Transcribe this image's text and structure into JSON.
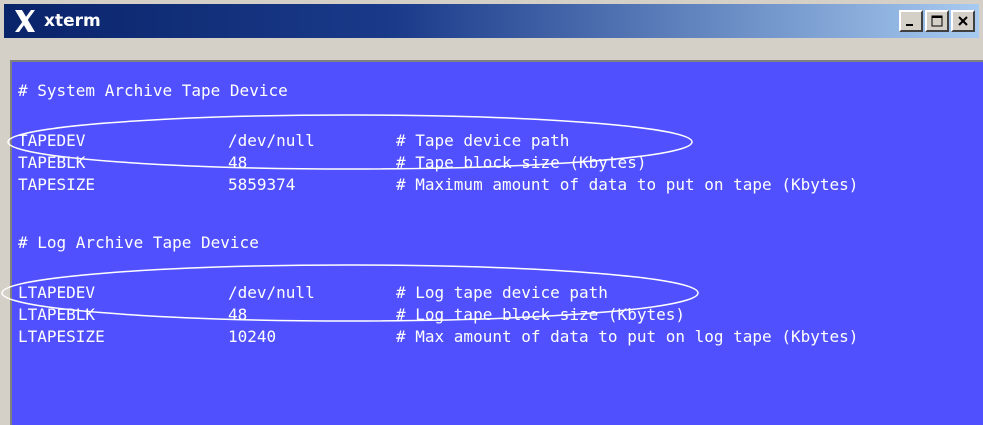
{
  "window": {
    "title": "xterm",
    "buttons": {
      "minimize": "minimize",
      "maximize": "maximize",
      "close": "close"
    }
  },
  "terminal": {
    "background": "#5050ff",
    "foreground": "#ffffff",
    "system_header": "# System Archive Tape Device",
    "system_rows": [
      {
        "name": "TAPEDEV",
        "value": "/dev/null",
        "comment": "# Tape device path"
      },
      {
        "name": "TAPEBLK",
        "value": "48",
        "comment": "# Tape block size (Kbytes)"
      },
      {
        "name": "TAPESIZE",
        "value": "5859374",
        "comment": "# Maximum amount of data to put on tape (Kbytes)"
      }
    ],
    "log_header": "# Log Archive Tape Device",
    "log_rows": [
      {
        "name": "LTAPEDEV",
        "value": "/dev/null",
        "comment": "# Log tape device path"
      },
      {
        "name": "LTAPEBLK",
        "value": "48",
        "comment": "# Log tape block size (Kbytes)"
      },
      {
        "name": "LTAPESIZE",
        "value": "10240",
        "comment": "# Max amount of data to put on log tape (Kbytes)"
      }
    ]
  },
  "annotations": {
    "highlight_ellipses": [
      "TAPEDEV row",
      "LTAPEDEV row"
    ],
    "ellipse_color": "#ffffff"
  }
}
